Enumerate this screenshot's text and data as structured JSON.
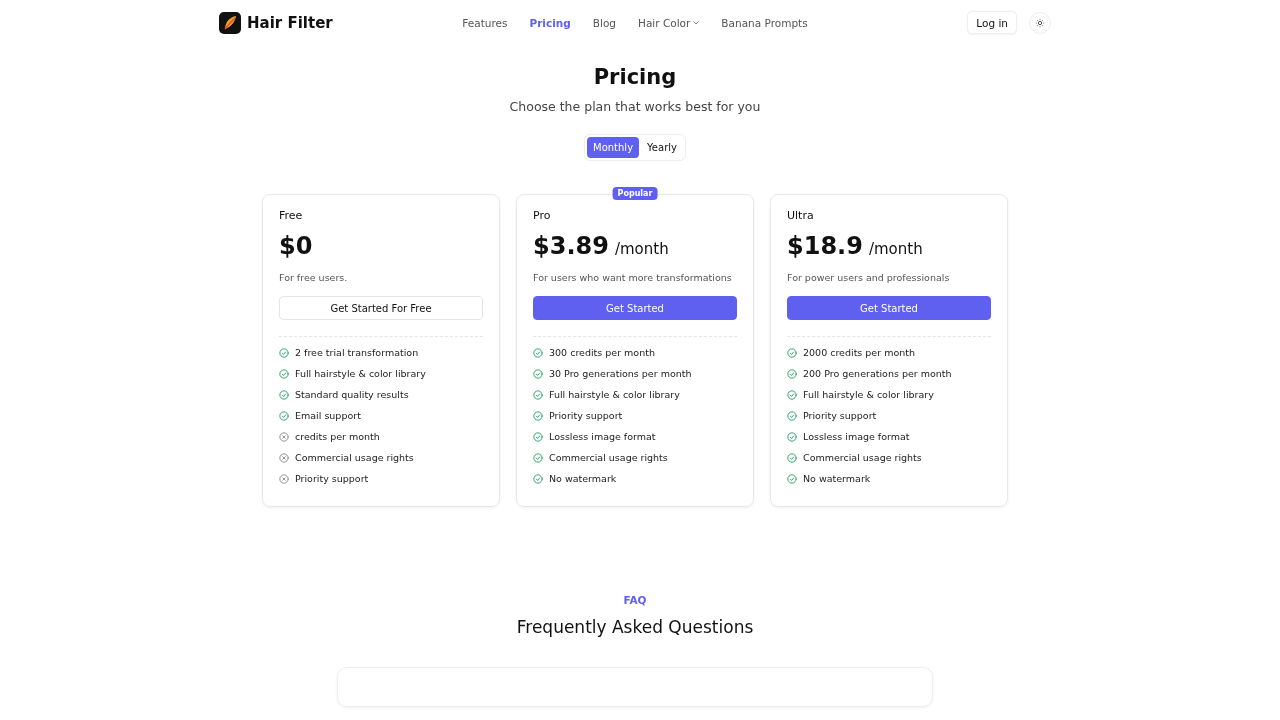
{
  "brand": {
    "name": "Hair Filter"
  },
  "nav": [
    {
      "label": "Features",
      "selected": false,
      "dropdown": false
    },
    {
      "label": "Pricing",
      "selected": true,
      "dropdown": false
    },
    {
      "label": "Blog",
      "selected": false,
      "dropdown": false
    },
    {
      "label": "Hair Color",
      "selected": false,
      "dropdown": true
    },
    {
      "label": "Banana Prompts",
      "selected": false,
      "dropdown": false
    }
  ],
  "login": "Log in",
  "title": "Pricing",
  "subtitle": "Choose the plan that works best for you",
  "billing": [
    {
      "label": "Monthly",
      "selected": true
    },
    {
      "label": "Yearly",
      "selected": false
    }
  ],
  "plans": [
    {
      "name": "Free",
      "price": "$0",
      "description": "For free users.",
      "button": "Get Started For Free",
      "primary": false,
      "features": [
        {
          "text": "2 free trial transformation",
          "included": true
        },
        {
          "text": "Full hairstyle & color library",
          "included": true
        },
        {
          "text": "Standard quality results",
          "included": true
        },
        {
          "text": "Email support",
          "included": true
        },
        {
          "text": "credits per month",
          "included": false
        },
        {
          "text": "Commercial usage rights",
          "included": false
        },
        {
          "text": "Priority support",
          "included": false
        }
      ]
    },
    {
      "name": "Pro",
      "badge": "Popular",
      "price": "$3.89",
      "period": "/month",
      "description": "For users who want more transformations",
      "button": "Get Started",
      "primary": true,
      "features": [
        {
          "text": "300 credits per month",
          "included": true
        },
        {
          "text": "30 Pro generations per month",
          "included": true
        },
        {
          "text": "Full hairstyle & color library",
          "included": true
        },
        {
          "text": "Priority support",
          "included": true
        },
        {
          "text": "Lossless image format",
          "included": true
        },
        {
          "text": "Commercial usage rights",
          "included": true
        },
        {
          "text": "No watermark",
          "included": true
        }
      ]
    },
    {
      "name": "Ultra",
      "price": "$18.9",
      "period": "/month",
      "description": "For power users and professionals",
      "button": "Get Started",
      "primary": true,
      "features": [
        {
          "text": "2000 credits per month",
          "included": true
        },
        {
          "text": "200 Pro generations per month",
          "included": true
        },
        {
          "text": "Full hairstyle & color library",
          "included": true
        },
        {
          "text": "Priority support",
          "included": true
        },
        {
          "text": "Lossless image format",
          "included": true
        },
        {
          "text": "Commercial usage rights",
          "included": true
        },
        {
          "text": "No watermark",
          "included": true
        }
      ]
    }
  ],
  "faq": {
    "eyebrow": "FAQ",
    "title": "Frequently Asked Questions"
  }
}
